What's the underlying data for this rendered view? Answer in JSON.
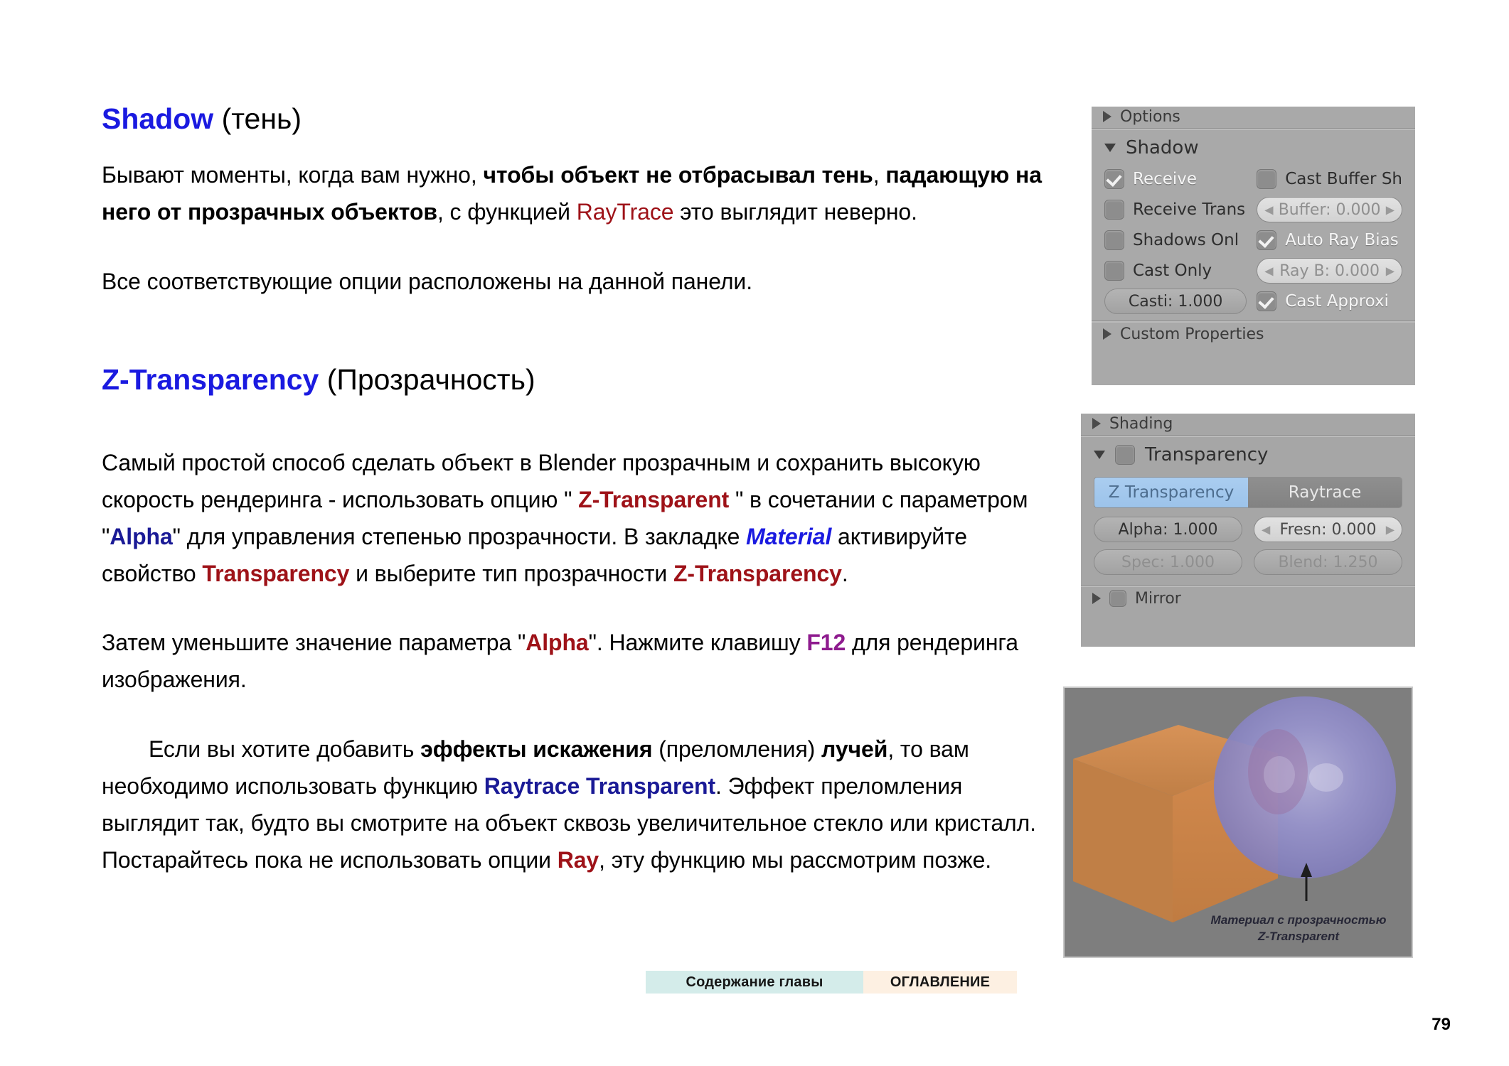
{
  "document": {
    "page_number": "79"
  },
  "sections": {
    "shadow": {
      "heading_term": "Shadow",
      "heading_translation": " (тень)",
      "paragraphs": [
        {
          "id": "p1",
          "runs": [
            {
              "t": "Бывают моменты, когда вам нужно, ",
              "style": "plain"
            },
            {
              "t": "чтобы объект не отбрасывал тень",
              "style": "bold"
            },
            {
              "t": ", ",
              "style": "plain"
            },
            {
              "t": "падающую на него от прозрачных объектов",
              "style": "bold"
            },
            {
              "t": ", с функцией ",
              "style": "plain"
            },
            {
              "t": "RayTrace",
              "style": "red"
            },
            {
              "t": " это выглядит неверно.",
              "style": "plain"
            }
          ]
        },
        {
          "id": "p2",
          "runs": [
            {
              "t": "Все соответствующие опции расположены на данной панели.",
              "style": "plain"
            }
          ]
        }
      ]
    },
    "ztransparency": {
      "heading_term": "Z-Transparency",
      "heading_translation": " (Прозрачность)",
      "paragraphs": [
        {
          "id": "p3",
          "runs": [
            {
              "t": "Самый простой способ сделать объект в Blender прозрачным и сохранить высокую скорость рендеринга - использовать опцию \" ",
              "style": "plain"
            },
            {
              "t": "Z-Transparent",
              "style": "redb"
            },
            {
              "t": " \" в сочетании с параметром \"",
              "style": "plain"
            },
            {
              "t": "Alpha",
              "style": "navy"
            },
            {
              "t": "\" для управления степенью прозрачности. В закладке ",
              "style": "plain"
            },
            {
              "t": "Material",
              "style": "blue-i"
            },
            {
              "t": " активируйте свойство ",
              "style": "plain"
            },
            {
              "t": "Transparency",
              "style": "redb"
            },
            {
              "t": " и выберите тип прозрачности ",
              "style": "plain"
            },
            {
              "t": "Z-Transparency",
              "style": "redb"
            },
            {
              "t": ".",
              "style": "plain"
            }
          ]
        },
        {
          "id": "p4",
          "runs": [
            {
              "t": "Затем уменьшите значение параметра \"",
              "style": "plain"
            },
            {
              "t": "Alpha",
              "style": "redb"
            },
            {
              "t": "\". Нажмите клавишу ",
              "style": "plain"
            },
            {
              "t": "F12",
              "style": "purple"
            },
            {
              "t": " для рендеринга изображения.",
              "style": "plain"
            }
          ]
        },
        {
          "id": "p5",
          "indent": true,
          "runs": [
            {
              "t": "Если вы хотите добавить ",
              "style": "plain"
            },
            {
              "t": "эффекты искажения",
              "style": "bold"
            },
            {
              "t": " (преломления) ",
              "style": "plain"
            },
            {
              "t": "лучей",
              "style": "bold"
            },
            {
              "t": ", то вам необходимо использовать функцию ",
              "style": "plain"
            },
            {
              "t": "Raytrace Transparent",
              "style": "navy"
            },
            {
              "t": ". Эффект преломления выглядит так, будто вы смотрите на объект сквозь увеличительное стекло или кристалл. Постарайтесь пока не использовать опции ",
              "style": "plain"
            },
            {
              "t": "Ray",
              "style": "redb"
            },
            {
              "t": ", эту функцию мы рассмотрим позже.",
              "style": "plain"
            }
          ]
        }
      ]
    }
  },
  "footer_nav": {
    "chapter_contents_label": "Содержание главы",
    "toc_label": "ОГЛАВЛЕНИЕ"
  },
  "blender": {
    "shadow_panel": {
      "above_header": "Options",
      "title": "Shadow",
      "below_header": "Custom Properties",
      "checkboxes": [
        {
          "label": "Receive",
          "checked": true,
          "light_label": true
        },
        {
          "label": "Cast Buffer Sh",
          "checked": false,
          "light_label": false
        },
        {
          "label": "Receive Trans",
          "checked": false,
          "light_label": false
        },
        {
          "label": "Shadows Onl",
          "checked": false,
          "light_label": false
        },
        {
          "label": "Auto Ray Bias",
          "checked": true,
          "light_label": true
        },
        {
          "label": "Cast Only",
          "checked": false,
          "light_label": false
        },
        {
          "label": "Cast Approxi",
          "checked": true,
          "light_label": true
        }
      ],
      "fields": {
        "buffer": "Buffer: 0.000",
        "ray_b": "Ray B: 0.000",
        "casti": "Casti: 1.000"
      }
    },
    "transparency_panel": {
      "above_header": "Shading",
      "title": "Transparency",
      "below_header": "Mirror",
      "enabled_checkbox": false,
      "segments": [
        {
          "label": "Z Transparency",
          "active": true
        },
        {
          "label": "Raytrace",
          "active": false
        }
      ],
      "fields": {
        "alpha": "Alpha: 1.000",
        "fresnel": "Fresn: 0.000",
        "spec": "Spec: 1.000",
        "blend": "Blend: 1.250"
      }
    },
    "render_preview": {
      "caption_line1": "Материал с прозрачностью",
      "caption_line2": "Z-Transparent",
      "background_color": "#7e7e7e",
      "cube_color": "#d08a4e",
      "sphere_color": "#8a86c4"
    }
  }
}
